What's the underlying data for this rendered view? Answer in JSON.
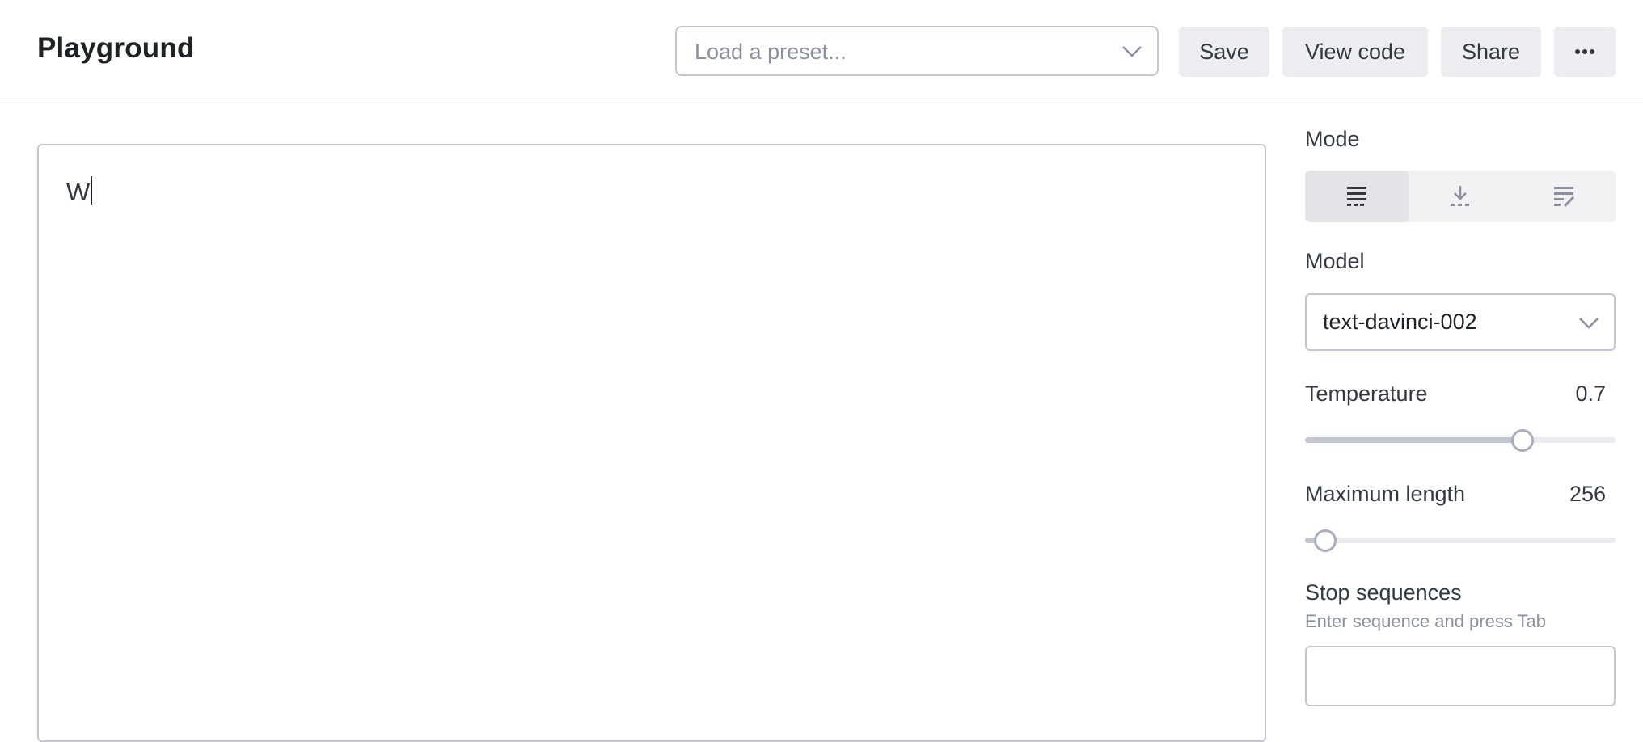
{
  "header": {
    "title": "Playground",
    "preset_placeholder": "Load a preset...",
    "save_label": "Save",
    "view_code_label": "View code",
    "share_label": "Share",
    "more_icon": "more-horizontal-icon"
  },
  "editor": {
    "content": "W"
  },
  "panel": {
    "mode": {
      "label": "Mode",
      "options": [
        {
          "icon": "complete-mode-icon",
          "active": true
        },
        {
          "icon": "insert-mode-icon",
          "active": false
        },
        {
          "icon": "edit-mode-icon",
          "active": false
        }
      ]
    },
    "model": {
      "label": "Model",
      "value": "text-davinci-002"
    },
    "temperature": {
      "label": "Temperature",
      "value": "0.7",
      "fraction": 0.7
    },
    "max_length": {
      "label": "Maximum length",
      "value": "256",
      "fraction": 0.064
    },
    "stop_sequences": {
      "label": "Stop sequences",
      "hint": "Enter sequence and press Tab"
    }
  },
  "colors": {
    "button_bg": "#ececf1",
    "border": "#c5c5d2",
    "muted_text": "#8e8ea0"
  }
}
